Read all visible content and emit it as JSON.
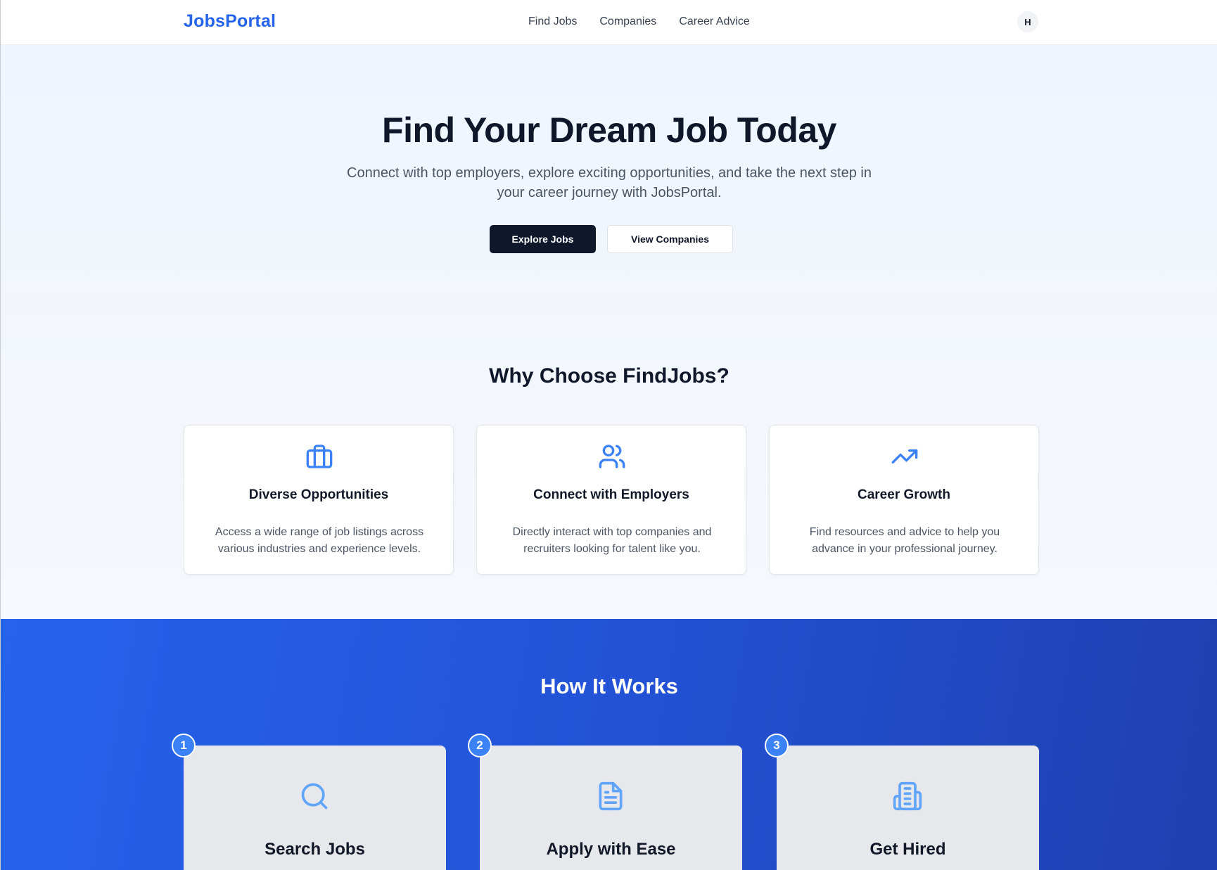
{
  "header": {
    "brand": "JobsPortal",
    "nav": [
      "Find Jobs",
      "Companies",
      "Career Advice"
    ],
    "avatar_initial": "H"
  },
  "hero": {
    "title": "Find Your Dream Job Today",
    "subtitle": "Connect with top employers, explore exciting opportunities, and take the next step in your career journey with JobsPortal.",
    "primary_cta": "Explore Jobs",
    "secondary_cta": "View Companies"
  },
  "why": {
    "title": "Why Choose FindJobs?",
    "features": [
      {
        "icon": "briefcase-icon",
        "title": "Diverse Opportunities",
        "description": "Access a wide range of job listings across various industries and experience levels."
      },
      {
        "icon": "users-icon",
        "title": "Connect with Employers",
        "description": "Directly interact with top companies and recruiters looking for talent like you."
      },
      {
        "icon": "trending-up-icon",
        "title": "Career Growth",
        "description": "Find resources and advice to help you advance in your professional journey."
      }
    ]
  },
  "how": {
    "title": "How It Works",
    "steps": [
      {
        "number": "1",
        "icon": "search-icon",
        "title": "Search Jobs"
      },
      {
        "number": "2",
        "icon": "document-icon",
        "title": "Apply with Ease"
      },
      {
        "number": "3",
        "icon": "building-icon",
        "title": "Get Hired"
      }
    ]
  },
  "colors": {
    "brand": "#2563eb",
    "primary_button": "#0f172a",
    "icon_blue": "#3b82f6",
    "step_icon": "#60a5fa"
  }
}
